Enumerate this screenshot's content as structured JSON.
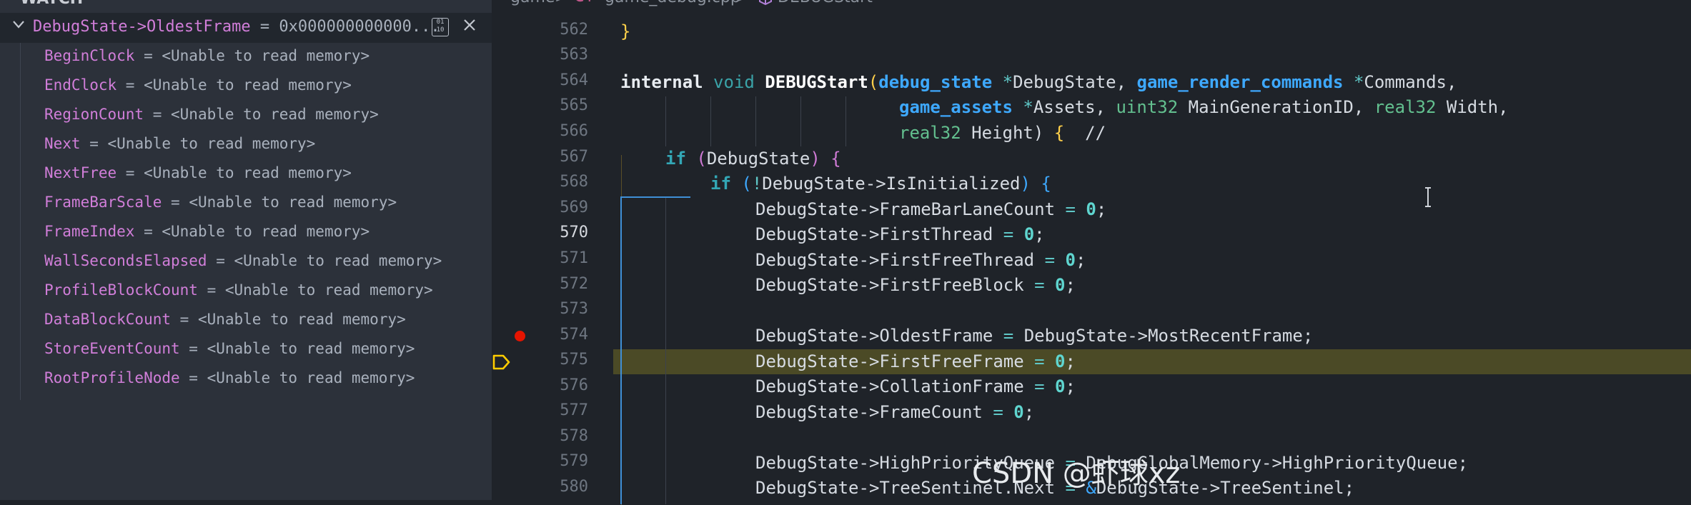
{
  "watch": {
    "title": "WATCH",
    "root_name": "DebugState->OldestFrame",
    "root_eq": " = ",
    "root_value": "0x000000000000...",
    "root_binary_label": "01\n10",
    "items": [
      {
        "name": "BeginClock",
        "eq": " = ",
        "value": "<Unable to read memory>"
      },
      {
        "name": "EndClock",
        "eq": " = ",
        "value": "<Unable to read memory>"
      },
      {
        "name": "RegionCount",
        "eq": " = ",
        "value": "<Unable to read memory>"
      },
      {
        "name": "Next",
        "eq": " = ",
        "value": "<Unable to read memory>"
      },
      {
        "name": "NextFree",
        "eq": " = ",
        "value": "<Unable to read memory>"
      },
      {
        "name": "FrameBarScale",
        "eq": " = ",
        "value": "<Unable to read memory>"
      },
      {
        "name": "FrameIndex",
        "eq": " = ",
        "value": "<Unable to read memory>"
      },
      {
        "name": "WallSecondsElapsed",
        "eq": " = ",
        "value": "<Unable to read memory>"
      },
      {
        "name": "ProfileBlockCount",
        "eq": " = ",
        "value": "<Unable to read memory>"
      },
      {
        "name": "DataBlockCount",
        "eq": " = ",
        "value": "<Unable to read memory>"
      },
      {
        "name": "StoreEventCount",
        "eq": " = ",
        "value": "<Unable to read memory>"
      },
      {
        "name": "RootProfileNode",
        "eq": " = ",
        "value": "<Unable to read memory>"
      }
    ]
  },
  "breadcrumb": {
    "folder": "game",
    "sep1": ">",
    "file_icon": "C+",
    "file": "game_debug.cpp",
    "sep2": ">",
    "symbol_icon": "cube-icon",
    "symbol": "DEBUGStart"
  },
  "editor": {
    "line_numbers": [
      "562",
      "563",
      "564",
      "565",
      "566",
      "567",
      "568",
      "569",
      "570",
      "571",
      "572",
      "573",
      "574",
      "575",
      "576",
      "577",
      "578",
      "579",
      "580"
    ],
    "current_line": "570",
    "breakpoint_line": "574",
    "execution_line": "575",
    "code": {
      "l562": "}",
      "l564_kw": "internal",
      "l564_void": "void",
      "l564_fn": "DEBUGStart",
      "l564_p1type": "debug_state",
      "l564_p1name": "DebugState,",
      "l564_p2type": "game_render_commands",
      "l564_p2name": "Commands,",
      "l565_type": "game_assets",
      "l565_name": "Assets,",
      "l565_t2": "uint32",
      "l565_n2": "MainGenerationID,",
      "l565_t3": "real32",
      "l565_n3": "Width,",
      "l566_type": "real32",
      "l566_name": "Height)",
      "l566_comment": "//",
      "l567_if": "if",
      "l567_cond": "DebugState",
      "l568_if": "if",
      "l568_cond": "DebugState->IsInitialized",
      "stmts": [
        {
          "lhs": "DebugState->FrameBarLaneCount",
          "rhs": "0"
        },
        {
          "lhs": "DebugState->FirstThread",
          "rhs": "0"
        },
        {
          "lhs": "DebugState->FirstFreeThread",
          "rhs": "0"
        },
        {
          "lhs": "DebugState->FirstFreeBlock",
          "rhs": "0"
        }
      ],
      "l574_lhs": "DebugState->OldestFrame",
      "l574_rhs": "DebugState->MostRecentFrame;",
      "stmts2": [
        {
          "lhs": "DebugState->FirstFreeFrame",
          "rhs": "0"
        },
        {
          "lhs": "DebugState->CollationFrame",
          "rhs": "0"
        },
        {
          "lhs": "DebugState->FrameCount",
          "rhs": "0"
        }
      ],
      "l579_lhs": "DebugState->HighPriorityQueue",
      "l579_rhs": "DebugGlobalMemory->HighPriorityQueue;",
      "l580_lhs": "DebugState->TreeSentinel.Next",
      "l580_rhs": "DebugState->TreeSentinel;"
    }
  },
  "watermark": "CSDN @虾球xz",
  "colors": {
    "breakpoint": "#e51400",
    "execution_highlight": "#4b4a26",
    "scope_guide": "#3f8fd6"
  }
}
